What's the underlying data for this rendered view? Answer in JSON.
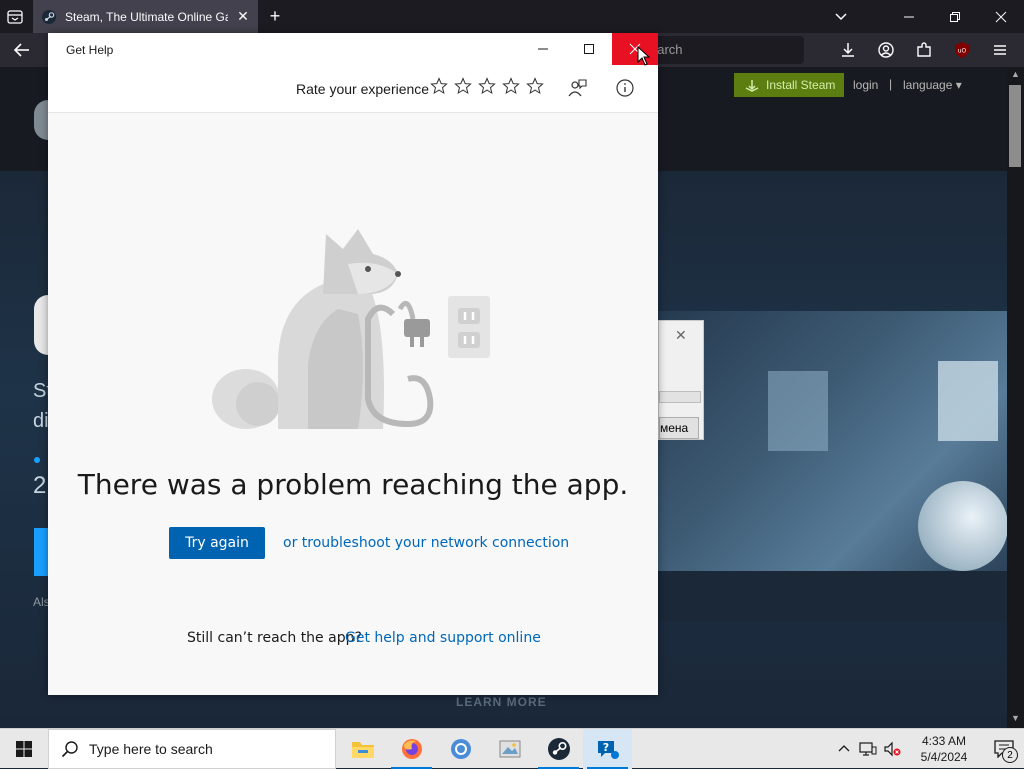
{
  "browser": {
    "tab_title": "Steam, The Ultimate Online Gan",
    "url_text": "earch"
  },
  "steam": {
    "install_label": "Install Steam",
    "login_label": "login",
    "separator": "|",
    "language_label": "language",
    "learn_more": "LEARN MORE",
    "left_text_1": "St",
    "left_text_2": "di",
    "left_text_3": "2",
    "left_text_4": "Als"
  },
  "mini_dialog": {
    "button_label": "мена"
  },
  "gethelp": {
    "title": "Get Help",
    "rate_label": "Rate your experience",
    "stars": 5,
    "heading": "There was a problem reaching the app.",
    "try_again_label": "Try again",
    "troubleshoot_link": "or troubleshoot your network connection",
    "still_text": "Still can’t reach the app?",
    "help_online_link": "Get help and support online"
  },
  "taskbar": {
    "search_placeholder": "Type here to search",
    "time": "4:33 AM",
    "date": "5/4/2024",
    "notification_count": "2"
  },
  "colors": {
    "close_red": "#e81123",
    "accent_blue": "#0063b1",
    "link_blue": "#0067b8",
    "steam_green": "#5c7e10"
  }
}
